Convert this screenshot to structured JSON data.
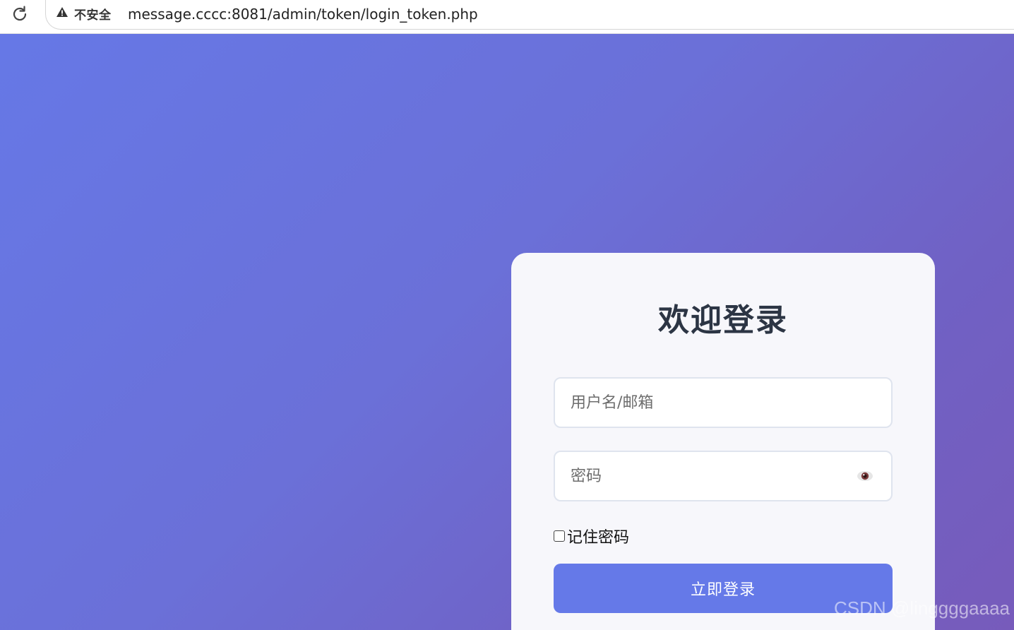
{
  "browser": {
    "security_label": "不安全",
    "url": "message.cccc:8081/admin/token/login_token.php"
  },
  "login": {
    "title": "欢迎登录",
    "username_placeholder": "用户名/邮箱",
    "password_placeholder": "密码",
    "remember_label": "记住密码",
    "submit_label": "立即登录"
  },
  "watermark": "CSDN @linggggaaaa",
  "colors": {
    "gradient_start": "#6678e6",
    "gradient_end": "#775bbb",
    "button": "#6579e8",
    "card": "#f7f7fb",
    "title": "#2c3544"
  },
  "icons": {
    "reload": "reload-icon",
    "warning": "warning-triangle-icon",
    "password_toggle": "eye-icon"
  }
}
